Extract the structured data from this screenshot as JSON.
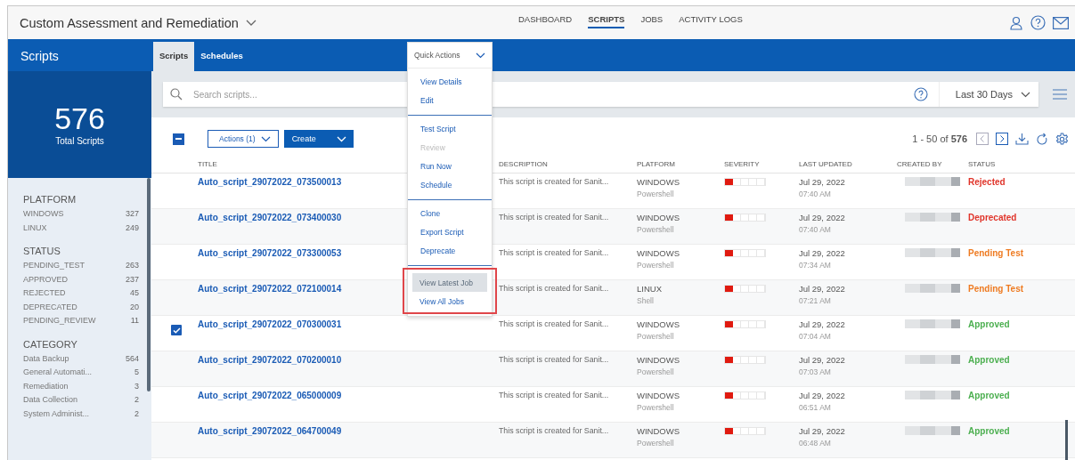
{
  "header": {
    "app_title": "Custom Assessment and Remediation",
    "nav": [
      {
        "label": "DASHBOARD",
        "selected": false
      },
      {
        "label": "SCRIPTS",
        "selected": true
      },
      {
        "label": "JOBS",
        "selected": false
      },
      {
        "label": "ACTIVITY LOGS",
        "selected": false
      }
    ]
  },
  "sidebar": {
    "title": "Scripts",
    "total": "576",
    "total_label": "Total Scripts",
    "filters": [
      {
        "title": "PLATFORM",
        "items": [
          {
            "label": "WINDOWS",
            "count": "327"
          },
          {
            "label": "LINUX",
            "count": "249"
          }
        ]
      },
      {
        "title": "STATUS",
        "items": [
          {
            "label": "PENDING_TEST",
            "count": "263"
          },
          {
            "label": "APPROVED",
            "count": "237"
          },
          {
            "label": "REJECTED",
            "count": "45"
          },
          {
            "label": "DEPRECATED",
            "count": "20"
          },
          {
            "label": "PENDING_REVIEW",
            "count": "11"
          }
        ]
      },
      {
        "title": "CATEGORY",
        "items": [
          {
            "label": "Data Backup",
            "count": "564"
          },
          {
            "label": "General Automati...",
            "count": "5"
          },
          {
            "label": "Remediation",
            "count": "3"
          },
          {
            "label": "Data Collection",
            "count": "2"
          },
          {
            "label": "System Administ...",
            "count": "2"
          }
        ]
      }
    ]
  },
  "tabs": [
    {
      "label": "Scripts",
      "selected": true
    },
    {
      "label": "Schedules",
      "selected": false
    }
  ],
  "quick_actions": {
    "label": "Quick Actions",
    "expanded": true,
    "groups": [
      {
        "annotated": false,
        "items": [
          {
            "label": "View Details",
            "disabled": false,
            "hovered": false
          },
          {
            "label": "Edit",
            "disabled": false,
            "hovered": false
          }
        ]
      },
      {
        "annotated": false,
        "items": [
          {
            "label": "Test Script",
            "disabled": false,
            "hovered": false
          },
          {
            "label": "Review",
            "disabled": true,
            "hovered": false
          },
          {
            "label": "Run Now",
            "disabled": false,
            "hovered": false
          },
          {
            "label": "Schedule",
            "disabled": false,
            "hovered": false
          }
        ]
      },
      {
        "annotated": false,
        "items": [
          {
            "label": "Clone",
            "disabled": false,
            "hovered": false
          },
          {
            "label": "Export Script",
            "disabled": false,
            "hovered": false
          },
          {
            "label": "Deprecate",
            "disabled": false,
            "hovered": false
          }
        ]
      },
      {
        "annotated": true,
        "items": [
          {
            "label": "View Latest Job",
            "disabled": false,
            "hovered": true
          },
          {
            "label": "View All Jobs",
            "disabled": false,
            "hovered": false
          }
        ]
      }
    ]
  },
  "search": {
    "placeholder": "Search scripts..."
  },
  "date_range": "Last 30 Days",
  "toolbar": {
    "select_all_indeterminate": true,
    "actions_label": "Actions (1)",
    "create_label": "Create",
    "pagination": "1 - 50 of **576**"
  },
  "table": {
    "columns": [
      "TITLE",
      "DESCRIPTION",
      "PLATFORM",
      "SEVERITY",
      "LAST UPDATED",
      "CREATED BY",
      "STATUS"
    ],
    "rows": [
      {
        "selected": false,
        "title": "Auto_script_29072022_073500013",
        "description": "This script is created for Sanit...",
        "platform": "WINDOWS",
        "type": "Powershell",
        "level": 0.2,
        "date": "Jul 29, 2022",
        "time": "07:40 AM",
        "status": "Rejected",
        "color": "#e0342a"
      },
      {
        "selected": false,
        "title": "Auto_script_29072022_073400030",
        "description": "This script is created for Sanit...",
        "platform": "WINDOWS",
        "type": "Powershell",
        "level": 0.2,
        "date": "Jul 29, 2022",
        "time": "07:40 AM",
        "status": "Deprecated",
        "color": "#e0342a"
      },
      {
        "selected": false,
        "title": "Auto_script_29072022_073300053",
        "description": "This script is created for Sanit...",
        "platform": "WINDOWS",
        "type": "Powershell",
        "level": 0.2,
        "date": "Jul 29, 2022",
        "time": "07:34 AM",
        "status": "Pending Test",
        "color": "#ee7b22"
      },
      {
        "selected": false,
        "title": "Auto_script_29072022_072100014",
        "description": "This script is created for Sanit...",
        "platform": "LINUX",
        "type": "Shell",
        "level": 0.2,
        "date": "Jul 29, 2022",
        "time": "07:21 AM",
        "status": "Pending Test",
        "color": "#ee7b22"
      },
      {
        "selected": true,
        "title": "Auto_script_29072022_070300031",
        "description": "This script is created for Sanit...",
        "platform": "WINDOWS",
        "type": "Powershell",
        "level": 0.2,
        "date": "Jul 29, 2022",
        "time": "07:04 AM",
        "status": "Approved",
        "color": "#4caf50"
      },
      {
        "selected": false,
        "title": "Auto_script_29072022_070200010",
        "description": "This script is created for Sanit...",
        "platform": "WINDOWS",
        "type": "Powershell",
        "level": 0.2,
        "date": "Jul 29, 2022",
        "time": "07:03 AM",
        "status": "Approved",
        "color": "#4caf50"
      },
      {
        "selected": false,
        "title": "Auto_script_29072022_065000009",
        "description": "This script is created for Sanit...",
        "platform": "WINDOWS",
        "type": "Powershell",
        "level": 0.2,
        "date": "Jul 29, 2022",
        "time": "06:51 AM",
        "status": "Approved",
        "color": "#4caf50"
      },
      {
        "selected": false,
        "title": "Auto_script_29072022_064700049",
        "description": "This script is created for Sanit...",
        "platform": "WINDOWS",
        "type": "Powershell",
        "level": 0.2,
        "date": "Jul 29, 2022",
        "time": "06:48 AM",
        "status": "Approved",
        "color": "#4caf50"
      }
    ]
  }
}
